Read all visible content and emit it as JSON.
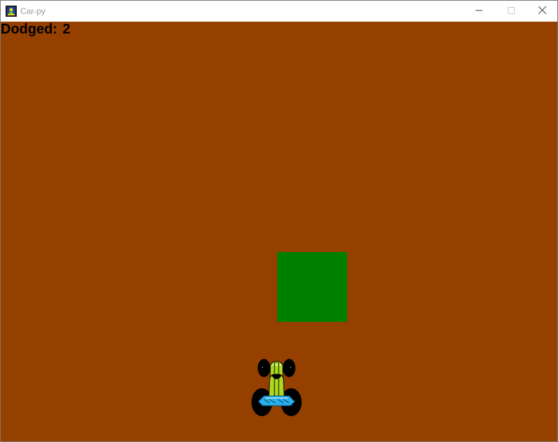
{
  "window": {
    "title": "Car-py",
    "icon": "python-pygame-icon",
    "controls": {
      "minimize_icon": "minimize-icon",
      "maximize_icon": "maximize-icon",
      "close_icon": "close-icon"
    }
  },
  "game": {
    "background_color": "#964000",
    "score": {
      "label": "Dodged:",
      "value": "2"
    },
    "obstacle": {
      "color": "#008000",
      "shape": "square"
    },
    "player": {
      "sprite": "racing-car",
      "body_color": "#b2d61e",
      "wheel_color": "#000000",
      "spoiler_color": "#2ab0e8"
    }
  }
}
